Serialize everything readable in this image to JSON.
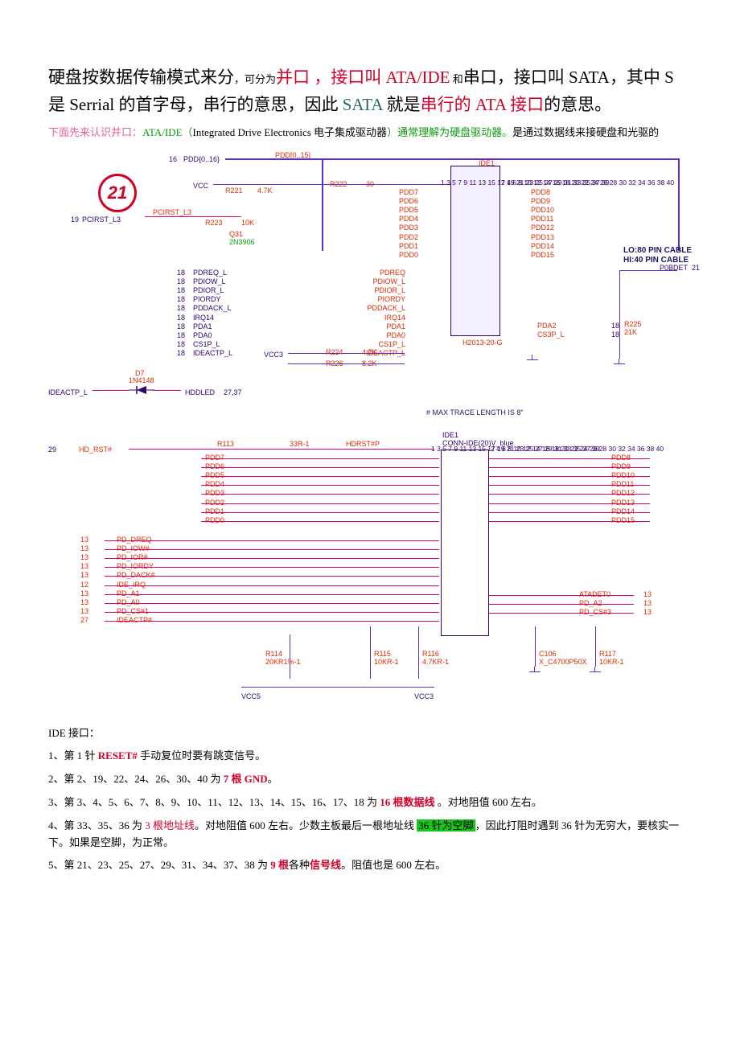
{
  "para1": {
    "t1": "硬盘按数据传输模式来分",
    "t2": "，可分为",
    "t3": "并口 ，接口叫 ATA/IDE",
    "t4": " 和",
    "t5": "串口，接口叫 SATA，其中 S 是 Serrial 的首字母，串行的意思，因此 ",
    "t6": "SATA",
    "t7": " 就是",
    "t8": "串行的 ATA 接口",
    "t9": "的意思。"
  },
  "para2": {
    "t1": "下面先来认识并口：",
    "t2": "ATA/IDE（",
    "t3": "Integrated Drive Electronics 电子集成驱动器",
    "t4": "）通常理解为硬盘驱动器。",
    "t5": "是通过数据线来接硬盘和光驱的"
  },
  "diagram1": {
    "circle": "21",
    "bus_name": "PDD[0..15]",
    "bus_port_num": "16",
    "bus_port_label": "PDD{0..16}",
    "vcc": "VCC",
    "r221": "R221",
    "r221v": "4.7K",
    "r222": "R222",
    "r222v": "30",
    "r223": "R223",
    "r223v": "10K",
    "q31": "Q31",
    "q31p": "2N3906",
    "pcirst_num": "19",
    "pcirst": "PCIRST_L3",
    "pcirst_sig": "PCIRST_L3",
    "ide1": "IDE1",
    "ide1_part": "H2013-20-G",
    "left_sigs_top": [
      "PDD7",
      "PDD6",
      "PDD5",
      "PDD4",
      "PDD3",
      "PDD2",
      "PDD1",
      "PDD0"
    ],
    "right_sigs_top": [
      "PDD8",
      "PDD9",
      "PDD10",
      "PDD11",
      "PDD12",
      "PDD13",
      "PDD14",
      "PDD15"
    ],
    "right_sigs_bot": [
      "PDA2",
      "CS3P_L"
    ],
    "right_sigs_bot_nums": [
      "18",
      "18"
    ],
    "left_sigs_bot": [
      "PDREQ",
      "PDIOW_L",
      "PDIOR_L",
      "PIORDY",
      "PDDACK_L",
      "IRQ14",
      "PDA1",
      "PDA0",
      "CS1P_L",
      "IDEACTP_L"
    ],
    "left_ports_bot": [
      "PDREQ_L",
      "PDIOW_L",
      "PDIOR_L",
      "PIORDY",
      "PDDACK_L",
      "IRQ14",
      "PDA1",
      "PDA0",
      "CS1P_L",
      "IDEACTP_L"
    ],
    "left_port_nums": [
      "18",
      "18",
      "18",
      "18",
      "18",
      "18",
      "18",
      "18",
      "18",
      "18"
    ],
    "vcc3": "VCC3",
    "r224": "R224",
    "r224v": "4.7K",
    "r226": "R226",
    "r226v": "8.2K",
    "r225": "R225",
    "r225v": "21K",
    "d7": "D7",
    "d7p": "1N4148",
    "ideactp": "IDEACTP_L",
    "hddled": "HDDLED",
    "hddled_num": "27,37",
    "cabledet": "P0BDET",
    "cabledet_num": "21",
    "note_lo": "LO:80 PIN CABLE",
    "note_hi": "HI:40 PIN CABLE",
    "note_max": "# MAX TRACE LENGTH IS 8\"",
    "pins_left": [
      "1",
      "3",
      "5",
      "7",
      "9",
      "11",
      "13",
      "15",
      "17",
      "19",
      "21",
      "23",
      "25",
      "27",
      "29",
      "31",
      "33",
      "35",
      "37",
      "39"
    ],
    "pins_right": [
      "2",
      "4",
      "6",
      "8",
      "10",
      "12",
      "14",
      "16",
      "18",
      "20",
      "22",
      "24",
      "26",
      "28",
      "30",
      "32",
      "34",
      "36",
      "38",
      "40"
    ]
  },
  "diagram2": {
    "hd_rst_num": "29",
    "hd_rst": "HD_RST#",
    "r113": "R113",
    "r113v": "33R-1",
    "hdrst_net": "HDRST#P",
    "ide1": "IDE1",
    "ide1_part": "CONN-IDE(20)V_blue",
    "left_sigs_top": [
      "PDD7",
      "PDD6",
      "PDD5",
      "PDD4",
      "PDD3",
      "PDD2",
      "PDD1",
      "PDD0"
    ],
    "right_sigs_top": [
      "PDD8",
      "PDD9",
      "PDD10",
      "PDD11",
      "PDD12",
      "PDD13",
      "PDD14",
      "PDD15"
    ],
    "left_sigs_bot": [
      "PD_DREQ",
      "PD_IOW#",
      "PD_IOR#",
      "PD_IORDY",
      "PD_DACK#",
      "IDE_IRQ",
      "PD_A1",
      "PD_A0",
      "PD_CS#1",
      "IDEACTP#"
    ],
    "left_nums_bot": [
      "13",
      "13",
      "13",
      "13",
      "13",
      "12",
      "13",
      "13",
      "13",
      "27"
    ],
    "right_sigs_bot": [
      "ATADET0",
      "PD_A2",
      "PD_CS#3"
    ],
    "right_nums_bot": [
      "13",
      "13",
      "13"
    ],
    "r114": "R114",
    "r114v": "20KR1%-1",
    "r115": "R115",
    "r115v": "10KR-1",
    "r116": "R116",
    "r116v": "4.7KR-1",
    "c106": "C106",
    "c106v": "X_C4700P50X",
    "r117": "R117",
    "r117v": "10KR-1",
    "vcc5": "VCC5",
    "vcc3": "VCC3",
    "pins_left": [
      "1",
      "3",
      "5",
      "7",
      "9",
      "11",
      "13",
      "15",
      "17",
      "19",
      "21",
      "23",
      "25",
      "27",
      "29",
      "31",
      "33",
      "35",
      "37",
      "39"
    ],
    "pins_right": [
      "2",
      "4",
      "6",
      "8",
      "10",
      "12",
      "14",
      "16",
      "18",
      "20",
      "22",
      "24",
      "26",
      "28",
      "30",
      "32",
      "34",
      "36",
      "38",
      "40"
    ]
  },
  "explain": {
    "title": "IDE 接口：",
    "l1a": "1、第 1 针 ",
    "l1b": "RESET#",
    "l1c": " 手动复位时要有跳变信号。",
    "l2a": "2、第 2、19、22、24、26、30、40 为 ",
    "l2b": "7 根 GND",
    "l2c": "。",
    "l3a": "3、第 3、4、5、6、7、8、9、10、11、12、13、14、15、16、17、18   为 ",
    "l3b": "16 根数据线 ",
    "l3c": "。对地阻值 600 左右。",
    "l4a": "4、第 33、35、36 为 ",
    "l4b": "3 根地址线",
    "l4c": "。对地阻值 600 左右。少数主板最后一根地址线 ",
    "l4d": "36 针为空脚",
    "l4e": "，因此打阻时遇到 36 针为无穷大，要核实一下。如果是空脚，为正常。",
    "l5a": "5、第 21、23、25、27、29、31、34、37、38 为 ",
    "l5b": "9 根",
    "l5c": "各种",
    "l5d": "信号线",
    "l5e": "。阻值也是 600 左右。"
  }
}
